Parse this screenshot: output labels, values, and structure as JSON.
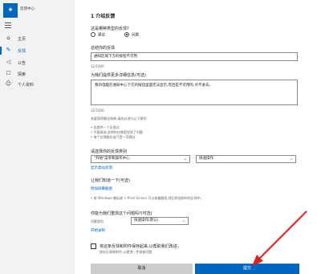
{
  "app": {
    "title": "反馈中心",
    "logo_glyph": "✦"
  },
  "sidebar": {
    "items": [
      {
        "icon": "home-icon",
        "glyph": "⌂",
        "label": "主页",
        "active": false
      },
      {
        "icon": "feedback-icon",
        "glyph": "✎",
        "label": "反馈",
        "active": true
      },
      {
        "icon": "megaphone-icon",
        "glyph": "◁",
        "label": "公告",
        "active": false
      },
      {
        "icon": "quests-icon",
        "glyph": "☐",
        "label": "探索",
        "active": false
      },
      {
        "icon": "person-icon",
        "glyph": "☺",
        "label": "个人资料",
        "active": false
      }
    ]
  },
  "form": {
    "section_title": "1 介绍反馈",
    "type_question": "这是哪种类型的反馈?",
    "type_options": [
      {
        "label": "建议",
        "checked": false
      },
      {
        "label": "问题",
        "checked": true
      }
    ],
    "summary_label": "总结你的反馈",
    "summary_value": "通知区域下方的按钮不可用",
    "summary_count": "12/1000",
    "details_label": "为我们提供更多详细信息(可选)",
    "details_value": "我的电脑在通知中心下方的按钮里面无法显示,而且是不可用的,点不进去。",
    "details_count": "32/1000",
    "tips_intro": "若要获得最佳效果,请务必进行以下操作:",
    "tips": [
      "• 仅提供一个反馈点",
      "• 尽量具体,说明你在哪里找到了问题",
      "• 每个反馈都应该只是一项建议"
    ],
    "category_label": "请选择你的反馈类别",
    "category_value": "\"开始\"菜单和操作中心",
    "subcategory_value": "快速操作",
    "similar_link": "显示类似反馈",
    "add_detail_label": "让我们知道一下(可选)",
    "attach_link": "附加屏幕截图",
    "screenshot_note": "• 按 Windows 徽标键 + Print Screen 可以拍摄截图,然后附加到你的反馈中。",
    "recreate_label": "你能为我们重现这个问题吗?(可选)",
    "recreate_category": "问题类别",
    "recreate_value": "快速操作(默认)",
    "start_link": "开始录制",
    "consent_label": "将这条反馈和附件保存起来,以帮助我们改进。",
    "consent_sub": "保存反馈和附件,以便进一步调查问题",
    "cancel_label": "取消",
    "submit_label": "提交"
  },
  "colors": {
    "accent": "#0067c0",
    "arrow": "#e02020"
  }
}
